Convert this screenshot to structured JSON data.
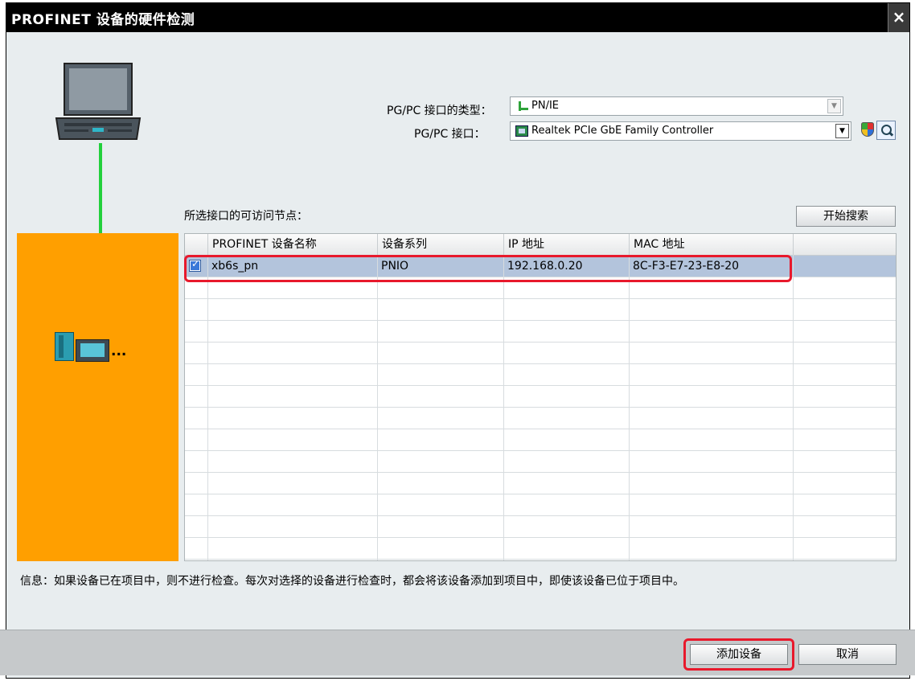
{
  "dialog": {
    "title": "PROFINET 设备的硬件检测",
    "close_label": "×"
  },
  "interface": {
    "type_label": "PG/PC 接口的类型：",
    "type_value": "PN/IE",
    "iface_label": "PG/PC 接口：",
    "iface_value": "Realtek PCIe GbE Family Controller"
  },
  "nodes": {
    "label": "所选接口的可访问节点：",
    "search_button": "开始搜索",
    "columns": [
      "PROFINET 设备名称",
      "设备系列",
      "IP 地址",
      "MAC 地址"
    ],
    "rows": [
      {
        "checked": true,
        "name": "xb6s_pn",
        "family": "PNIO",
        "ip": "192.168.0.20",
        "mac": "8C-F3-E7-23-E8-20"
      }
    ]
  },
  "devices_ellipsis": "...",
  "info_text": "信息：如果设备已在项目中，则不进行检查。每次对选择的设备进行检查时，都会将该设备添加到项目中，即使该设备已位于项目中。",
  "footer": {
    "add_button": "添加设备",
    "cancel_button": "取消"
  },
  "colors": {
    "highlight": "#e8192c",
    "accent_orange": "#ff9f00",
    "link_green": "#22d03c",
    "selected_row": "#b3c4dc"
  }
}
